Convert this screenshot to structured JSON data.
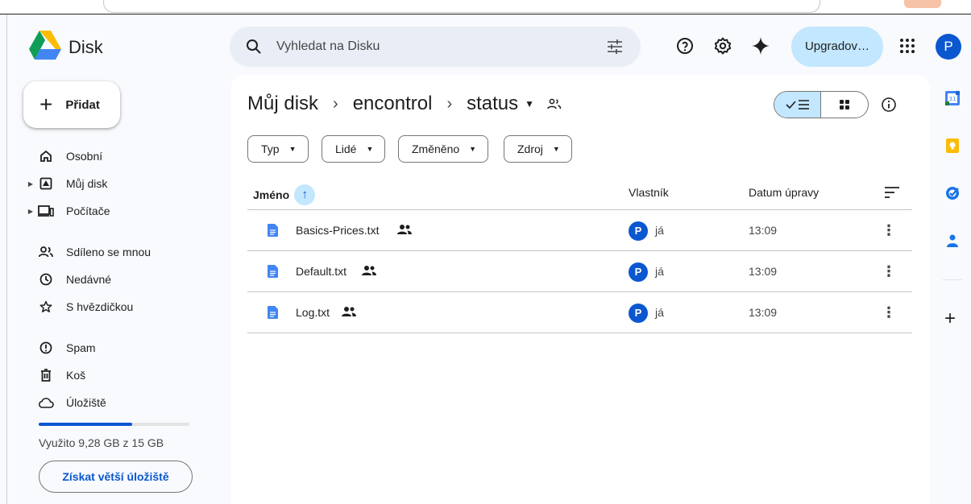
{
  "app": {
    "name": "Disk"
  },
  "search": {
    "placeholder": "Vyhledat na Disku"
  },
  "header": {
    "upgrade_label": "Upgradov…",
    "avatar_letter": "P"
  },
  "sidebar": {
    "new_label": "Přidat",
    "items": [
      {
        "label": "Osobní"
      },
      {
        "label": "Můj disk"
      },
      {
        "label": "Počítače"
      },
      {
        "label": "Sdíleno se mnou"
      },
      {
        "label": "Nedávné"
      },
      {
        "label": "S hvězdičkou"
      },
      {
        "label": "Spam"
      },
      {
        "label": "Koš"
      },
      {
        "label": "Úložiště"
      }
    ],
    "storage_text": "Využito 9,28 GB z 15 GB",
    "storage_used_fraction": 0.619,
    "more_storage_label": "Získat větší úložiště"
  },
  "breadcrumb": {
    "root": "Můj disk",
    "mid": "encontrol",
    "current": "status"
  },
  "filters": [
    {
      "label": "Typ"
    },
    {
      "label": "Lidé"
    },
    {
      "label": "Změněno"
    },
    {
      "label": "Zdroj"
    }
  ],
  "table": {
    "col_name": "Jméno",
    "col_owner": "Vlastník",
    "col_date": "Datum úpravy",
    "rows": [
      {
        "name": "Basics-Prices.txt",
        "owner_letter": "P",
        "owner": "já",
        "date": "13:09"
      },
      {
        "name": "Default.txt",
        "owner_letter": "P",
        "owner": "já",
        "date": "13:09"
      },
      {
        "name": "Log.txt",
        "owner_letter": "P",
        "owner": "já",
        "date": "13:09"
      }
    ]
  },
  "colors": {
    "accent": "#0b57d0",
    "selected": "#c2e7ff",
    "search_bg": "#e9eef6"
  }
}
